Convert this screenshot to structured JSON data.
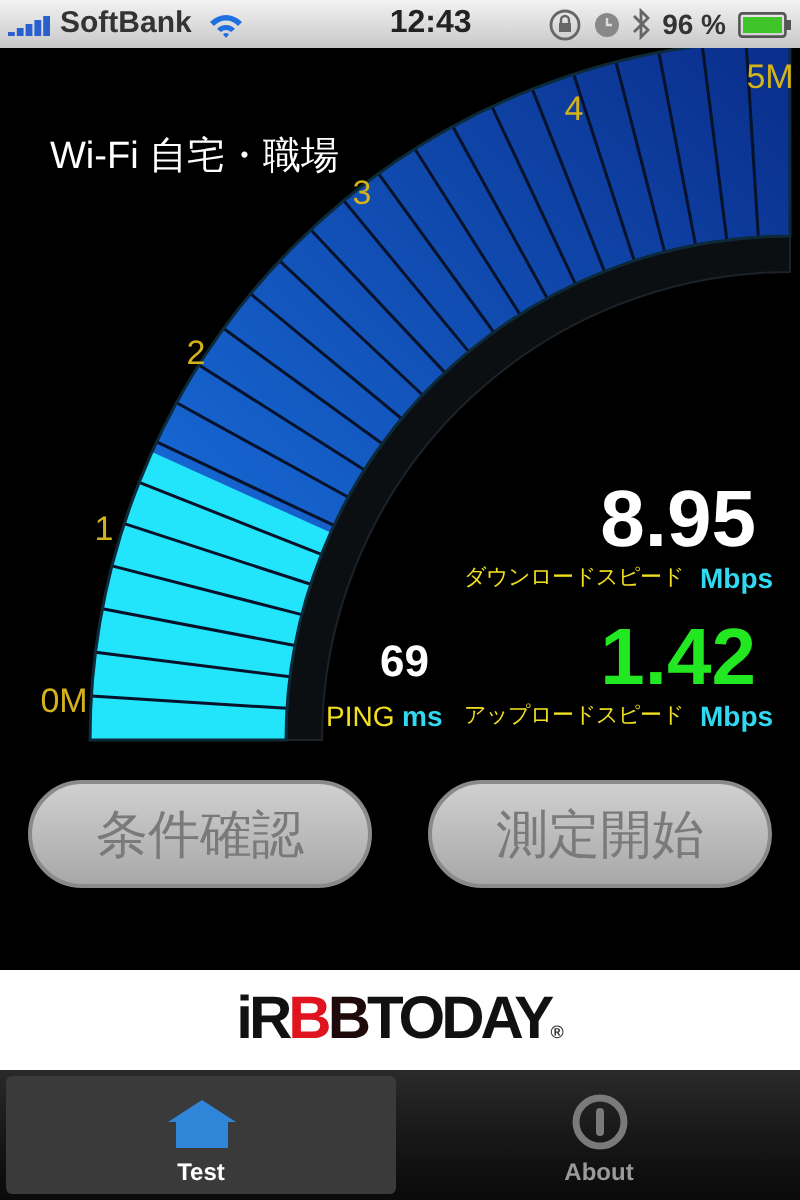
{
  "status_bar": {
    "carrier": "SoftBank",
    "time": "12:43",
    "battery": "96 %"
  },
  "network": {
    "title": "Wi-Fi 自宅・職場"
  },
  "gauge": {
    "ticks": [
      "0M",
      "1",
      "2",
      "3",
      "4",
      "5M"
    ]
  },
  "download": {
    "value": "8.95",
    "label": "ダウンロードスピード",
    "unit": "Mbps"
  },
  "upload": {
    "value": "1.42",
    "label": "アップロードスピード",
    "unit": "Mbps"
  },
  "ping": {
    "value": "69",
    "label": "PING",
    "unit": "ms"
  },
  "buttons": [
    "条件確認",
    "測定開始"
  ],
  "banner": {
    "parts": [
      {
        "text": "iR",
        "color": "#111111"
      },
      {
        "text": "B",
        "color": "#e0141e"
      },
      {
        "text": "B",
        "color": "#1e0a0a"
      },
      {
        "text": "TODAY",
        "color": "#111111"
      }
    ],
    "mark": "®"
  },
  "tabs": [
    {
      "label": "Test",
      "kind": "home",
      "selected": true
    },
    {
      "label": "About",
      "kind": "info",
      "selected": false
    }
  ]
}
